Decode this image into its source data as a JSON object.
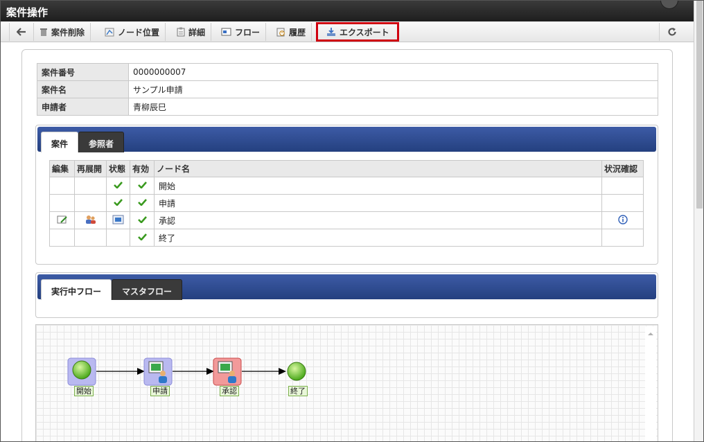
{
  "window": {
    "title": "案件操作"
  },
  "toolbar": {
    "back_icon": "arrow-left-icon",
    "delete_label": "案件削除",
    "node_position_label": "ノード位置",
    "detail_label": "詳細",
    "flow_label": "フロー",
    "history_label": "履歴",
    "export_label": "エクスポート",
    "refresh_icon": "refresh-icon"
  },
  "info": {
    "rows": [
      {
        "key": "案件番号",
        "value": "0000000007"
      },
      {
        "key": "案件名",
        "value": "サンプル申請"
      },
      {
        "key": "申請者",
        "value": "青柳辰巳"
      }
    ]
  },
  "panel1": {
    "tabs": [
      {
        "label": "案件",
        "active": true
      },
      {
        "label": "参照者",
        "active": false
      }
    ],
    "table": {
      "headers": [
        "編集",
        "再展開",
        "状態",
        "有効",
        "ノード名",
        "状況確認"
      ],
      "rows": [
        {
          "node": "開始"
        },
        {
          "node": "申請"
        },
        {
          "node": "承認"
        },
        {
          "node": "終了"
        }
      ]
    }
  },
  "panel2": {
    "tabs": [
      {
        "label": "実行中フロー",
        "active": true
      },
      {
        "label": "マスタフロー",
        "active": false
      }
    ]
  },
  "flow": {
    "nodes": [
      {
        "label": "開始"
      },
      {
        "label": "申請"
      },
      {
        "label": "承認"
      },
      {
        "label": "終了"
      }
    ]
  },
  "colors": {
    "tab_bar": "#2f4d94",
    "export_highlight": "#d0000f",
    "check": "#3a9a1f"
  }
}
